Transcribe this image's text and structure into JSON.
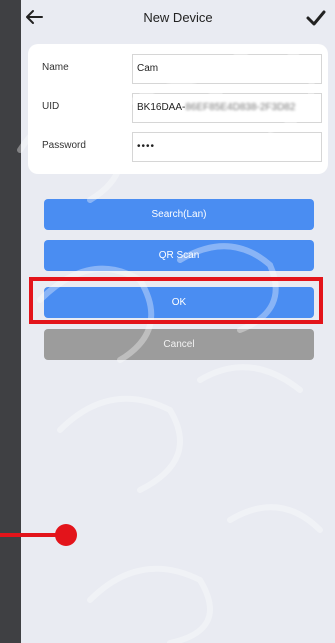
{
  "header": {
    "title": "New Device",
    "back_icon": "arrow-left-icon",
    "confirm_icon": "checkmark-icon"
  },
  "form": {
    "name": {
      "label": "Name",
      "value": "Cam"
    },
    "uid": {
      "label": "UID",
      "value_prefix": "BK16DAA-",
      "value_obscured": "86EF85E4D838-2F3D82"
    },
    "password": {
      "label": "Password",
      "value": "••••"
    }
  },
  "buttons": {
    "search_lan": "Search(Lan)",
    "qr_scan": "QR Scan",
    "ok": "OK",
    "cancel": "Cancel"
  },
  "colors": {
    "accent_blue": "#4a8df2",
    "highlight_red": "#e3141b",
    "cancel_gray": "#9c9c9c"
  }
}
